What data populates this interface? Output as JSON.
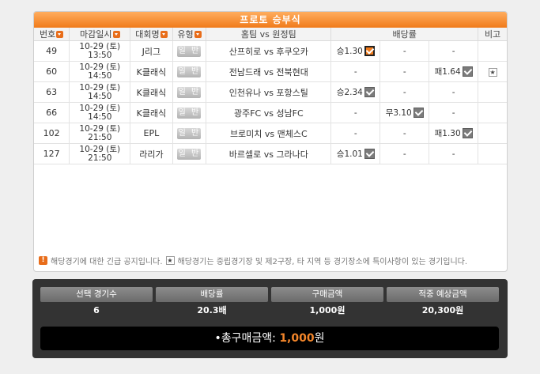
{
  "panel": {
    "title": "프로토 승부식"
  },
  "columns": [
    "번호",
    "마감일시",
    "대회명",
    "유형",
    "홈팀 vs 원정팀",
    "배당률",
    "비고"
  ],
  "rows": [
    {
      "no": "49",
      "date": "10-29 (토)",
      "time": "13:50",
      "league": "J리그",
      "type": "일 반",
      "match": "산프히로 vs 후쿠오카",
      "win": "승1.30",
      "draw": "-",
      "lose": "-",
      "win_chk": true,
      "win_sel": true,
      "draw_chk": false,
      "lose_chk": false,
      "note": ""
    },
    {
      "no": "60",
      "date": "10-29 (토)",
      "time": "14:50",
      "league": "K클래식",
      "type": "일 반",
      "match": "전남드래 vs 전북현대",
      "win": "-",
      "draw": "-",
      "lose": "패1.64",
      "win_chk": false,
      "draw_chk": false,
      "lose_chk": true,
      "note": "★"
    },
    {
      "no": "63",
      "date": "10-29 (토)",
      "time": "14:50",
      "league": "K클래식",
      "type": "일 반",
      "match": "인천유나 vs 포항스틸",
      "win": "승2.34",
      "draw": "-",
      "lose": "-",
      "win_chk": true,
      "draw_chk": false,
      "lose_chk": false,
      "note": ""
    },
    {
      "no": "66",
      "date": "10-29 (토)",
      "time": "14:50",
      "league": "K클래식",
      "type": "일 반",
      "match": "광주FC vs 성남FC",
      "win": "-",
      "draw": "무3.10",
      "lose": "-",
      "win_chk": false,
      "draw_chk": true,
      "lose_chk": false,
      "note": ""
    },
    {
      "no": "102",
      "date": "10-29 (토)",
      "time": "21:50",
      "league": "EPL",
      "type": "일 반",
      "match": "브로미치 vs 맨체스C",
      "win": "-",
      "draw": "-",
      "lose": "패1.30",
      "win_chk": false,
      "draw_chk": false,
      "lose_chk": true,
      "note": ""
    },
    {
      "no": "127",
      "date": "10-29 (토)",
      "time": "21:50",
      "league": "라리가",
      "type": "일 반",
      "match": "바르셀로 vs 그라나다",
      "win": "승1.01",
      "draw": "-",
      "lose": "-",
      "win_chk": true,
      "draw_chk": false,
      "lose_chk": false,
      "note": ""
    }
  ],
  "notice": {
    "urgent": "해당경기에 대한 긴급 공지입니다.",
    "star": "해당경기는 중립경기장 및 제2구장, 타 지역 등 경기장소에 특이사항이 있는 경기입니다."
  },
  "summary": {
    "headers": [
      "선택 경기수",
      "배당률",
      "구매금액",
      "적중 예상금액"
    ],
    "values": [
      "6",
      "20.3배",
      "1,000원",
      "20,300원"
    ],
    "total_label": "•총구매금액:",
    "total_amount": "1,000",
    "total_unit": "원"
  }
}
